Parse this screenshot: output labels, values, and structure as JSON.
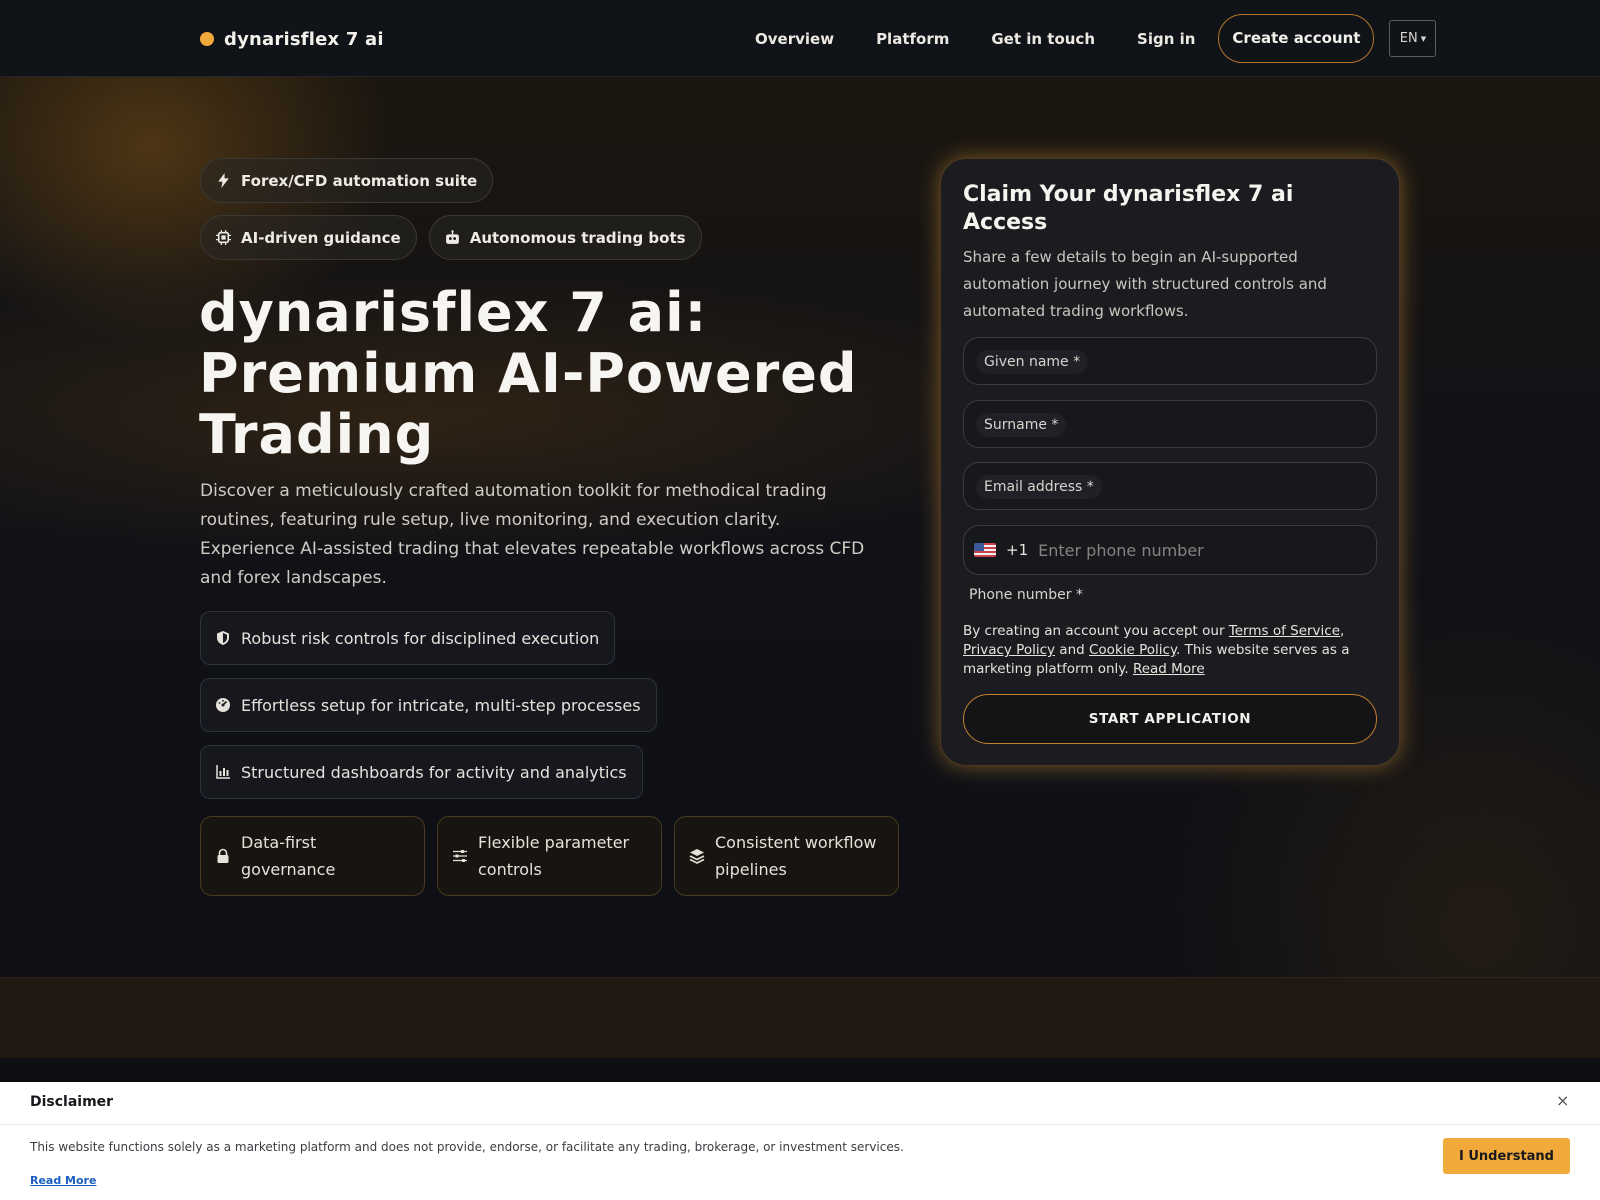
{
  "header": {
    "brand": "dynarisflex 7 ai",
    "nav": [
      "Overview",
      "Platform",
      "Get in touch",
      "Sign in"
    ],
    "cta": "Create account",
    "language": "EN"
  },
  "hero": {
    "chips": [
      {
        "label": "Forex/CFD automation suite",
        "icon": "bolt-icon"
      },
      {
        "label": "AI-driven guidance",
        "icon": "chip-icon"
      },
      {
        "label": "Autonomous trading bots",
        "icon": "robot-icon"
      }
    ],
    "headline": "dynarisflex 7 ai: Premium AI-Powered Trading",
    "lead": "Discover a meticulously crafted automation toolkit for methodical trading routines, featuring rule setup, live monitoring, and execution clarity. Experience AI-assisted trading that elevates repeatable workflows across CFD and forex landscapes.",
    "features": [
      {
        "label": "Robust risk controls for disciplined execution",
        "icon": "shield-icon"
      },
      {
        "label": "Effortless setup for intricate, multi-step processes",
        "icon": "gauge-icon"
      },
      {
        "label": "Structured dashboards for activity and analytics",
        "icon": "bar-chart-icon"
      }
    ],
    "tiles": [
      {
        "label": "Data-first governance",
        "icon": "lock-icon"
      },
      {
        "label": "Flexible parameter controls",
        "icon": "sliders-icon"
      },
      {
        "label": "Consistent workflow pipelines",
        "icon": "layers-icon"
      }
    ]
  },
  "form": {
    "title": "Claim Your dynarisflex 7 ai Access",
    "subtitle": "Share a few details to begin an AI-supported automation journey with structured controls and automated trading workflows.",
    "given_name": "Given name *",
    "surname": "Surname *",
    "email": "Email address *",
    "dial_code": "+1",
    "phone_placeholder": "Enter phone number",
    "phone_label": "Phone number *",
    "terms_prefix": "By creating an account you accept our ",
    "terms_link": "Terms of Service",
    "privacy_link": "Privacy Policy",
    "and": " and ",
    "cookie_link": "Cookie Policy",
    "terms_suffix": ". This website serves as a marketing platform only. ",
    "read_more": "Read More",
    "submit": "START APPLICATION"
  },
  "disclaimer": {
    "title": "Disclaimer",
    "close": "×",
    "text": "This website functions solely as a marketing platform and does not provide, endorse, or facilitate any trading, brokerage, or investment services.",
    "read_more": "Read More",
    "button": "I Understand"
  },
  "colors": {
    "accent": "#f2a93b",
    "background": "#0d0f13",
    "card": "#1c1c20"
  }
}
